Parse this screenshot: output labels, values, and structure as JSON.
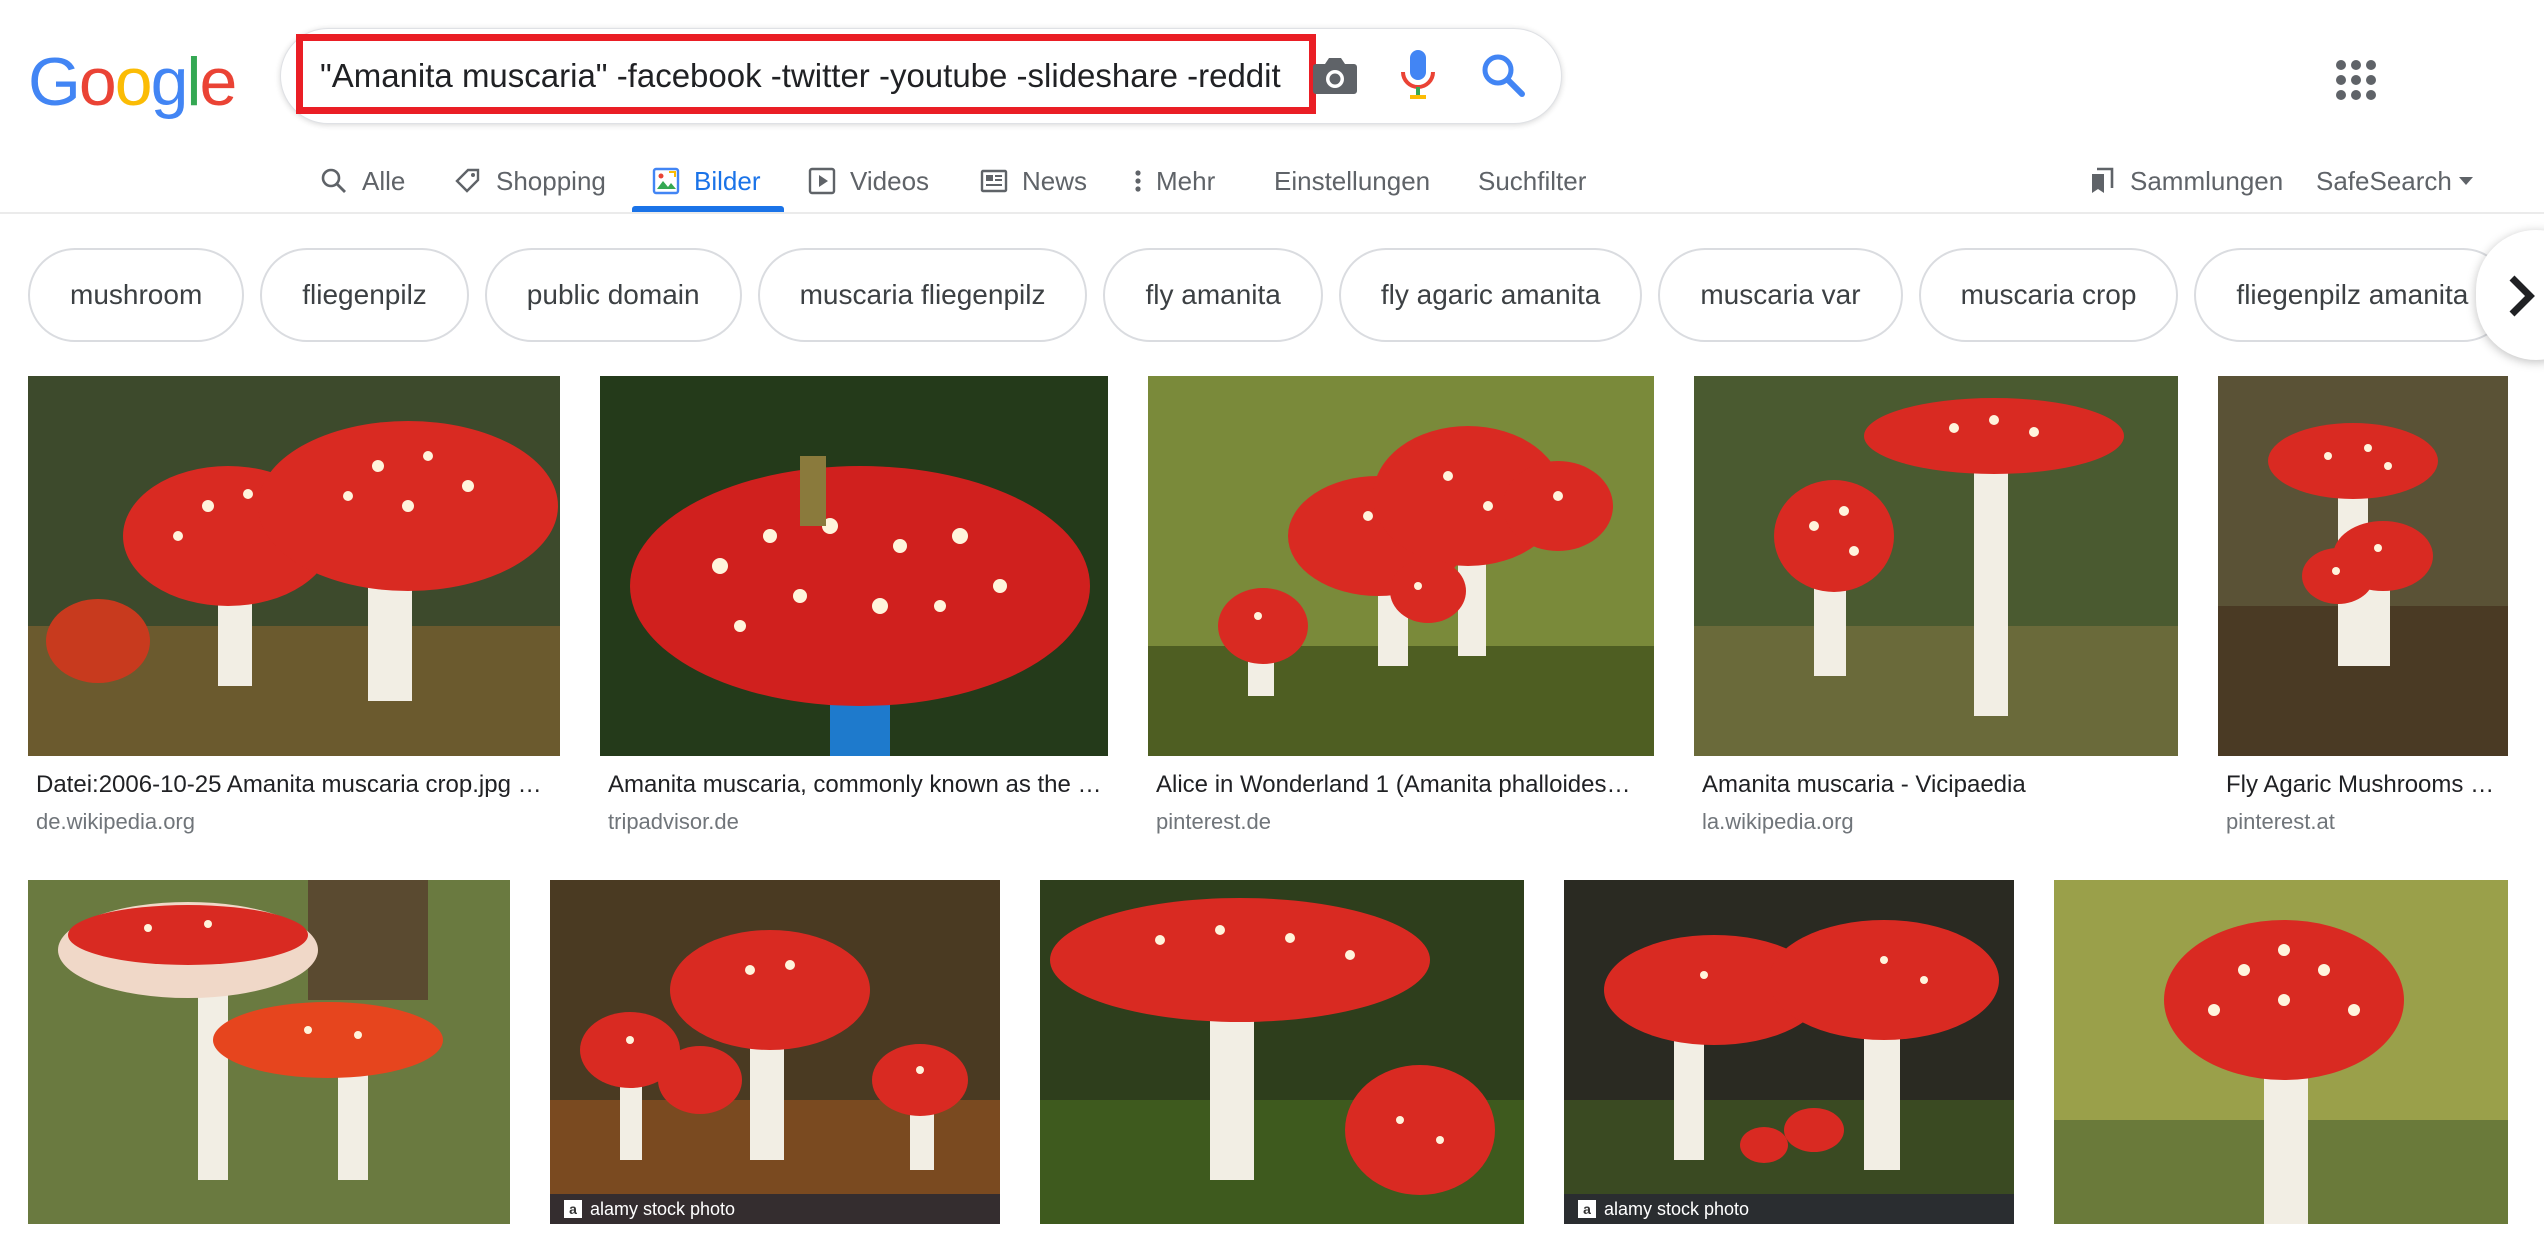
{
  "header": {
    "logo_letters": [
      {
        "ch": "G",
        "color": "#4285F4"
      },
      {
        "ch": "o",
        "color": "#EA4335"
      },
      {
        "ch": "o",
        "color": "#FBBC05"
      },
      {
        "ch": "g",
        "color": "#4285F4"
      },
      {
        "ch": "l",
        "color": "#34A853"
      },
      {
        "ch": "e",
        "color": "#EA4335"
      }
    ],
    "query": "\"Amanita muscaria\" -facebook -twitter -youtube -slideshare -reddit"
  },
  "nav": {
    "alle": "Alle",
    "shopping": "Shopping",
    "bilder": "Bilder",
    "videos": "Videos",
    "news": "News",
    "mehr": "Mehr",
    "einstellungen": "Einstellungen",
    "suchfilter": "Suchfilter",
    "sammlungen": "Sammlungen",
    "safesearch": "SafeSearch"
  },
  "chips": [
    "mushroom",
    "fliegenpilz",
    "public domain",
    "muscaria fliegenpilz",
    "fly amanita",
    "fly agaric amanita",
    "muscaria var",
    "muscaria crop",
    "fliegenpilz amanita"
  ],
  "results": [
    {
      "title": "Datei:2006-10-25 Amanita muscaria crop.jpg …",
      "source": "de.wikipedia.org"
    },
    {
      "title": "Amanita muscaria, commonly known as the fly agaric",
      "source": "tripadvisor.de"
    },
    {
      "title": "Alice in Wonderland 1 (Amanita phalloides…",
      "source": "pinterest.de"
    },
    {
      "title": "Amanita muscaria - Vicipaedia",
      "source": "la.wikipedia.org"
    },
    {
      "title": "Fly Agaric Mushrooms …",
      "source": "pinterest.at"
    },
    {
      "title": "",
      "source": ""
    },
    {
      "title": "",
      "source": "",
      "watermark": "alamy stock photo"
    },
    {
      "title": "",
      "source": ""
    },
    {
      "title": "",
      "source": "",
      "watermark": "alamy stock photo"
    },
    {
      "title": "",
      "source": ""
    }
  ],
  "colors": {
    "accent": "#1a73e8",
    "highlight": "#ea1e25",
    "cap": "#d92a22"
  }
}
